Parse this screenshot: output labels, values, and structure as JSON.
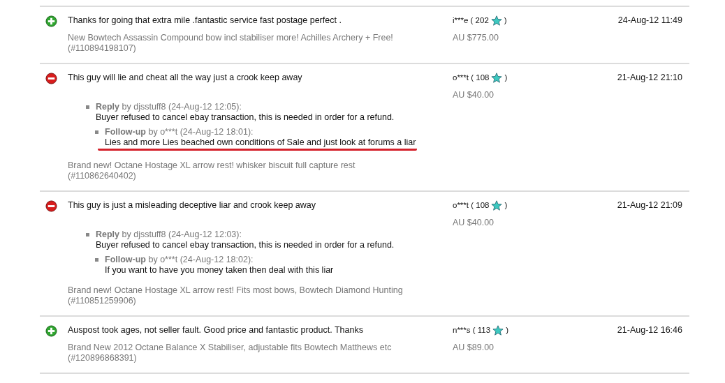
{
  "feedback": [
    {
      "kind": "positive",
      "comment": "Thanks for going that extra mile .fantastic service fast postage perfect .",
      "item": "New Bowtech Assassin Compound bow incl stabiliser more! Achilles Archery + Free!",
      "item_number": "(#110894198107)",
      "buyer": "i***e ( 202",
      "buyer_end": ")",
      "price": "AU $775.00",
      "date": "24-Aug-12 11:49"
    },
    {
      "kind": "negative",
      "comment": "This guy will lie and cheat all the way just a crook keep away",
      "item": "Brand new! Octane Hostage XL arrow rest! whisker biscuit full capture rest",
      "item_number": "(#110862640402)",
      "buyer": "o***t ( 108",
      "buyer_end": ")",
      "price": "AU $40.00",
      "date": "21-Aug-12 21:10",
      "replies": [
        {
          "header": "**Reply** by djsstuff8 (24-Aug-12 12:05):",
          "text": "Buyer refused to cancel ebay transaction, this is needed in order for a refund.",
          "underlined": false,
          "children": [
            {
              "header": "**Follow-up** by o***t (24-Aug-12 18:01):",
              "text": "Lies and more Lies beached own conditions of Sale and just look at forums a liar",
              "underlined": true
            }
          ]
        }
      ]
    },
    {
      "kind": "negative",
      "comment": "This guy is just a misleading deceptive liar and crook keep away",
      "item": "Brand new! Octane Hostage XL arrow rest! Fits most bows, Bowtech Diamond Hunting",
      "item_number": "(#110851259906)",
      "buyer": "o***t ( 108",
      "buyer_end": ")",
      "price": "AU $40.00",
      "date": "21-Aug-12 21:09",
      "replies": [
        {
          "header": "**Reply** by djsstuff8 (24-Aug-12 12:03):",
          "text": "Buyer refused to cancel ebay transaction, this is needed in order for a refund.",
          "underlined": false,
          "children": [
            {
              "header": "**Follow-up** by o***t (24-Aug-12 18:02):",
              "text": "If you want to have you money taken then deal with this liar",
              "underlined": false
            }
          ]
        }
      ]
    },
    {
      "kind": "positive",
      "comment": "Auspost took ages, not seller fault. Good price and fantastic product. Thanks",
      "item": "Brand New 2012 Octane Balance X Stabiliser, adjustable fits Bowtech Matthews etc",
      "item_number": "(#120896868391)",
      "buyer": "n***s ( 113",
      "buyer_end": ")",
      "price": "AU $89.00",
      "date": "21-Aug-12 16:46"
    }
  ]
}
